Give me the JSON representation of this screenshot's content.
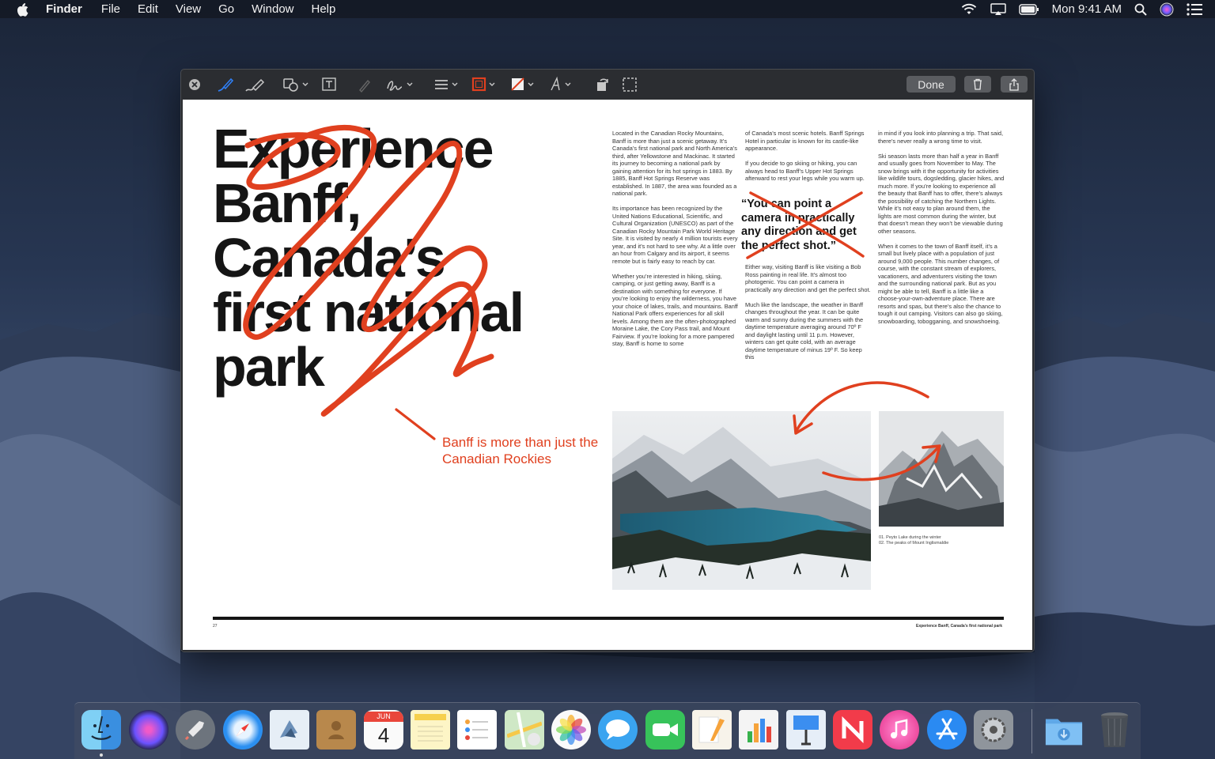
{
  "menubar": {
    "app_name": "Finder",
    "menus": [
      "File",
      "Edit",
      "View",
      "Go",
      "Window",
      "Help"
    ],
    "clock": "Mon 9:41 AM"
  },
  "toolbar": {
    "done_label": "Done"
  },
  "document": {
    "headline": [
      "Experience",
      "Banff,",
      "Canada’s",
      "first national",
      "park"
    ],
    "column1": [
      "Located in the Canadian Rocky Mountains, Banff is more than just a scenic getaway. It’s Canada’s first national park and North America’s third, after Yellowstone and Mackinac. It started its journey to becoming a national park by gaining attention for its hot springs in 1883. By 1885, Banff Hot Springs Reserve was established. In 1887, the area was founded as a national park.",
      "Its importance has been recognized by the United Nations Educational, Scientific, and Cultural Organization (UNESCO) as part of the Canadian Rocky Mountain Park World Heritage Site. It is visited by nearly 4 million tourists every year, and it’s not hard to see why. At a little over an hour from Calgary and its airport, it seems remote but is fairly easy to reach by car.",
      "Whether you’re interested in hiking, skiing, camping, or just getting away, Banff is a destination with something for everyone. If you’re looking to enjoy the wilderness, you have your choice of lakes, trails, and mountains. Banff National Park offers experiences for all skill levels. Among them are the often-photographed Moraine Lake, the Cory Pass trail, and Mount Fairview. If you’re looking for a more pampered stay, Banff is home to some"
    ],
    "column2_top": [
      "of Canada’s most scenic hotels. Banff Springs Hotel in particular is known for its castle-like appearance.",
      "If you decide to go skiing or hiking, you can always head to Banff’s Upper Hot Springs afterward to rest your legs while you warm up."
    ],
    "pullquote": "“You can point a camera in practically any direction and get the perfect shot.”",
    "column2_bottom": [
      "Either way, visiting Banff is like visiting a Bob Ross painting in real life. It’s almost too photogenic. You can point a camera in practically any direction and get the perfect shot.",
      "Much like the landscape, the weather in Banff changes throughout the year. It can be quite warm and sunny during the summers with the daytime temperature averaging around 70º F and daylight lasting until 11 p.m. However, winters can get quite cold, with an average daytime temperature of minus 19º F. So keep this"
    ],
    "column3": [
      "in mind if you look into planning a trip. That said, there’s never really a wrong time to visit.",
      "Ski season lasts more than half a year in Banff and usually goes from November to May. The snow brings with it the opportunity for activities like wildlife tours, dogsledding, glacier hikes, and much more. If you’re looking to experience all the beauty that Banff has to offer, there’s always the possibility of catching the Northern Lights. While it’s not easy to plan around them, the lights are most common during the winter, but that doesn’t mean they won’t be viewable during other seasons.",
      "When it comes to the town of Banff itself, it’s a small but lively place with a population of just around 9,000 people. This number changes, of course, with the constant stream of explorers, vacationers, and adventurers visiting the town and the surrounding national park. But as you might be able to tell, Banff is a little like a choose-your-own-adventure place. There are resorts and spas, but there’s also the chance to tough it out camping. Visitors can also go skiing, snowboarding, tobogganing, and snowshoeing."
    ],
    "captions": [
      "01. Peyto Lake during the winter",
      "02. The peaks of Mount Inglismaldie"
    ],
    "page_number": "27",
    "footer_title": "Experience Banff, Canada’s first national park",
    "annotation": "Banff is more than just the Canadian Rockies"
  },
  "dock": {
    "calendar_month": "JUN",
    "calendar_day": "4",
    "apps": [
      "finder-icon",
      "siri-icon",
      "launchpad-icon",
      "safari-icon",
      "mail-icon",
      "contacts-icon",
      "calendar-icon",
      "notes-icon",
      "reminders-icon",
      "maps-icon",
      "photos-icon",
      "messages-icon",
      "facetime-icon",
      "pages-icon",
      "numbers-icon",
      "keynote-icon",
      "news-icon",
      "itunes-icon",
      "app-store-icon",
      "system-preferences-icon",
      "downloads-folder-icon",
      "trash-icon"
    ]
  },
  "colors": {
    "markup_red": "#e0401f",
    "toolbar_blue": "#2f7ff5"
  }
}
